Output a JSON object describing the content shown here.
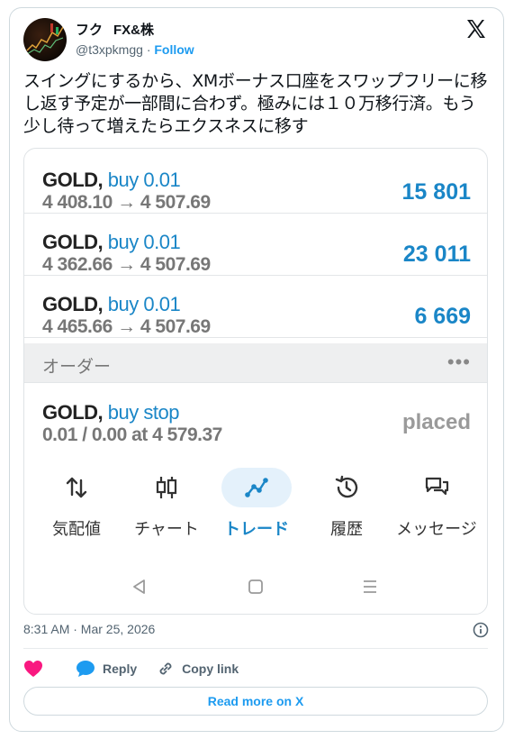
{
  "author": {
    "display_name_1": "フク",
    "display_name_2": "FX&株",
    "handle": "@t3xpkmgg",
    "separator": "·",
    "follow_label": "Follow"
  },
  "tweet_text": "スイングにするから、XMボーナス口座をスワップフリーに移し返す予定が一部間に合わず。極みには１０万移行済。もう少し待って増えたらエクスネスに移す",
  "positions": [
    {
      "symbol": "GOLD,",
      "side": "buy 0.01",
      "price": "4 408.10 → 4 507.69",
      "pnl": "15 801"
    },
    {
      "symbol": "GOLD,",
      "side": "buy 0.01",
      "price": "4 362.66 → 4 507.69",
      "pnl": "23 011"
    },
    {
      "symbol": "GOLD,",
      "side": "buy 0.01",
      "price": "4 465.66 → 4 507.69",
      "pnl": "6 669"
    }
  ],
  "orders_header": {
    "label": "オーダー",
    "more": "•••"
  },
  "order": {
    "symbol": "GOLD,",
    "side": "buy stop",
    "detail": "0.01 / 0.00 at 4 579.37",
    "status": "placed"
  },
  "bottom_nav": [
    {
      "label": "気配値",
      "icon": "swap-arrows-icon"
    },
    {
      "label": "チャート",
      "icon": "candlestick-icon"
    },
    {
      "label": "トレード",
      "icon": "trend-line-icon",
      "active": true
    },
    {
      "label": "履歴",
      "icon": "history-icon"
    },
    {
      "label": "メッセージ",
      "icon": "chat-icon"
    }
  ],
  "timestamp": "8:31 AM · Mar 25, 2026",
  "actions": {
    "reply": "Reply",
    "copy_link": "Copy link"
  },
  "read_more": "Read more on X",
  "colors": {
    "accent": "#1a86c7",
    "twitter_blue": "#1d9bf0",
    "heart": "#f91880"
  }
}
